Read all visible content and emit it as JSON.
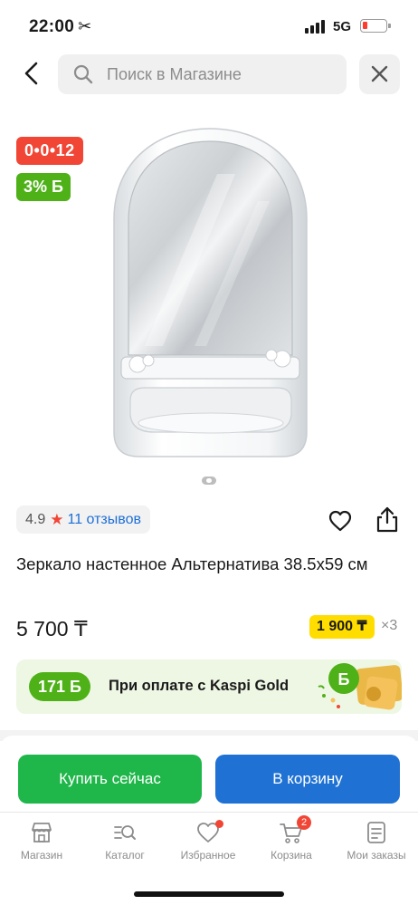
{
  "status_bar": {
    "time": "22:00",
    "network": "5G"
  },
  "search": {
    "placeholder": "Поиск в Магазине"
  },
  "badges": {
    "installment": "0•0•12",
    "bonus": "3% Б"
  },
  "rating": {
    "value": "4.9",
    "reviews": "11 отзывов"
  },
  "product": {
    "title": "Зеркало настенное Альтернатива 38.5x59 см",
    "price": "5 700 ₸",
    "monthly_payment": "1 900 ₸",
    "months": "×3"
  },
  "kaspi_gold": {
    "bonus": "171 Б",
    "text": "При оплате с Kaspi Gold"
  },
  "actions": {
    "buy_now": "Купить сейчас",
    "add_to_cart": "В корзину"
  },
  "tabs": [
    {
      "label": "Магазин",
      "icon": "store-icon"
    },
    {
      "label": "Каталог",
      "icon": "catalog-search-icon"
    },
    {
      "label": "Избранное",
      "icon": "heart-icon"
    },
    {
      "label": "Корзина",
      "icon": "cart-icon",
      "badge": "2"
    },
    {
      "label": "Мои заказы",
      "icon": "orders-icon"
    }
  ],
  "colors": {
    "accent_red": "#f14635",
    "accent_green": "#4fb118",
    "buy_green": "#1fb64a",
    "cart_blue": "#1f72d3",
    "price_yellow": "#ffdd00",
    "link_blue": "#1e6fd9"
  }
}
